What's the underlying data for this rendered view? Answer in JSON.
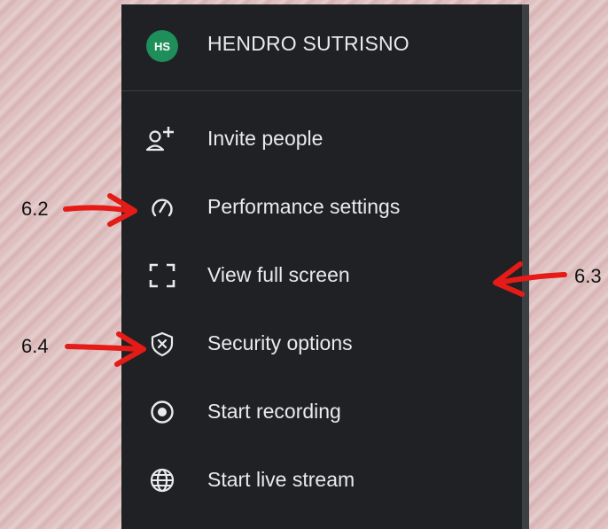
{
  "user": {
    "initials": "HS",
    "name": "HENDRO SUTRISNO",
    "avatar_color": "#1e8e5a"
  },
  "menu": {
    "background": "#202124",
    "items": [
      {
        "label": "Invite people",
        "icon": "add-person-icon"
      },
      {
        "label": "Performance settings",
        "icon": "gauge-icon"
      },
      {
        "label": "View full screen",
        "icon": "fullscreen-icon"
      },
      {
        "label": "Security options",
        "icon": "shield-icon"
      },
      {
        "label": "Start recording",
        "icon": "record-icon"
      },
      {
        "label": "Start live stream",
        "icon": "globe-icon"
      }
    ]
  },
  "annotations": {
    "a1": "6.2",
    "a2": "6.3",
    "a3": "6.4",
    "arrow_color": "#e41b17"
  }
}
